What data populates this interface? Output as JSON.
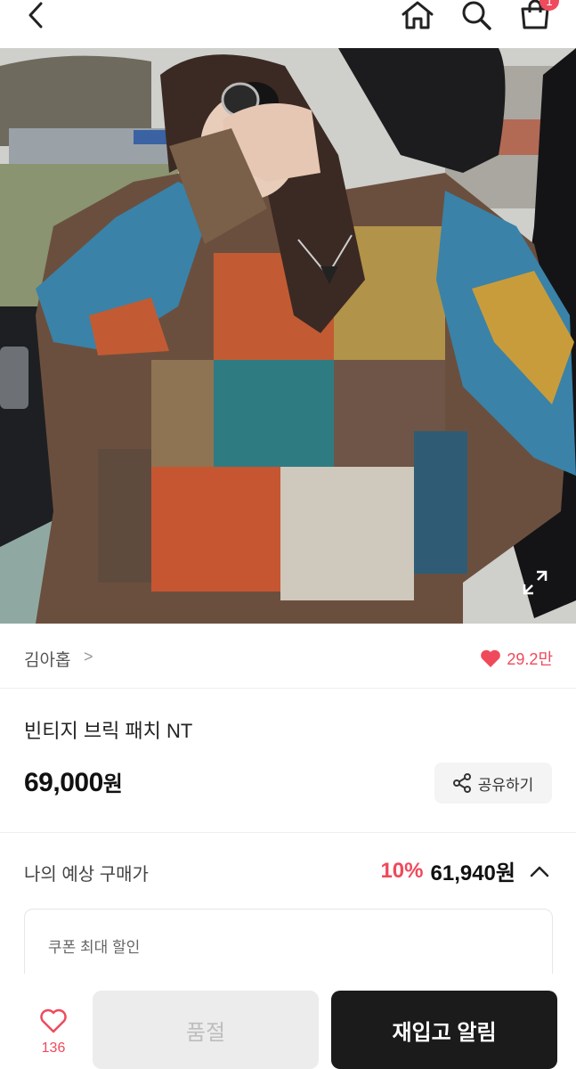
{
  "header": {
    "back_icon": "chevron-left-icon",
    "home_icon": "home-icon",
    "search_icon": "search-icon",
    "cart_icon": "shopping-bag-icon",
    "cart_badge": "1"
  },
  "product": {
    "image": "product-photo",
    "expand_icon": "expand-icon",
    "store_name": "김아홉",
    "store_chevron": ">",
    "like_count": "29.2만",
    "title": "빈티지 브릭 패치 NT",
    "price": "69,000",
    "price_unit": "원",
    "share_label": "공유하기"
  },
  "estimate": {
    "label": "나의 예상 구매가",
    "discount": "10%",
    "price": "61,940원",
    "coupon_label": "쿠폰 최대 할인"
  },
  "bottom": {
    "wish_count": "136",
    "soldout_label": "품절",
    "restock_label": "재입고 알림"
  },
  "colors": {
    "accent": "#ef4a5c",
    "dark_button": "#1b1b1b",
    "disabled_button": "#ececec"
  }
}
